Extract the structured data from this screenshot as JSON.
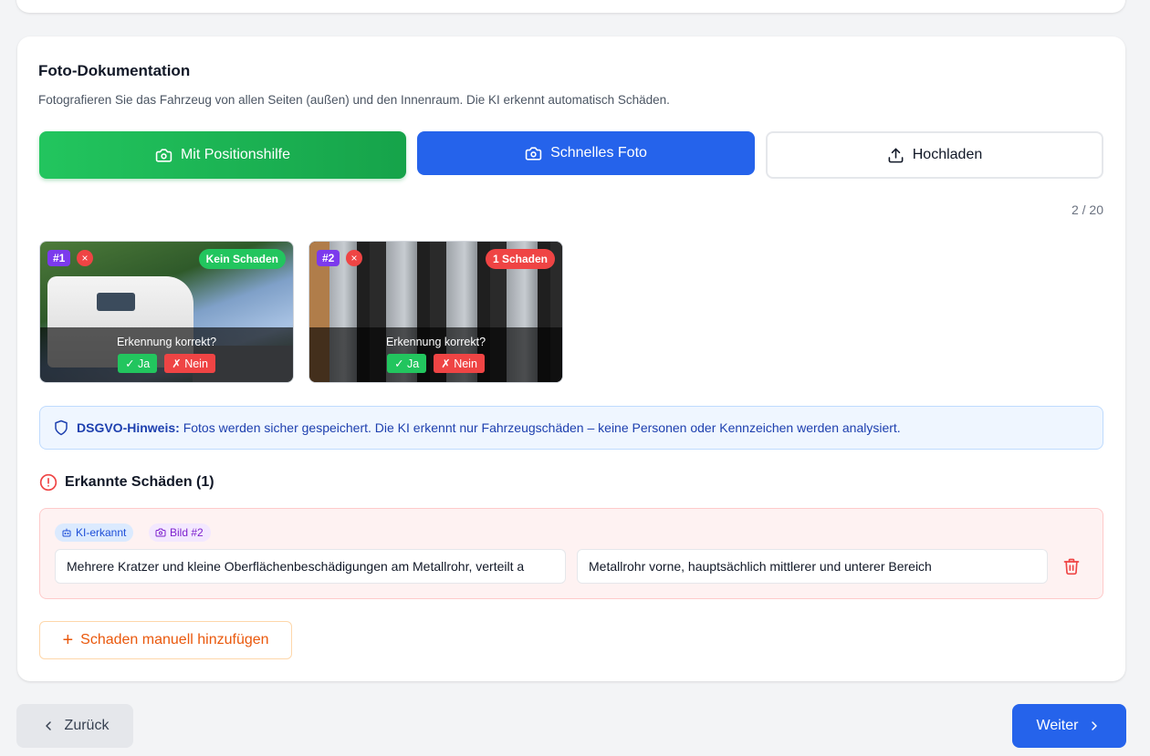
{
  "section": {
    "title": "Foto-Dokumentation",
    "subtitle": "Fotografieren Sie das Fahrzeug von allen Seiten (außen) und den Innenraum. Die KI erkennt automatisch Schäden."
  },
  "actions": {
    "position_help": "Mit Positionshilfe",
    "quick_photo": "Schnelles Foto",
    "upload": "Hochladen"
  },
  "photo_counter": "2 / 20",
  "photos": [
    {
      "number": "#1",
      "remove": "×",
      "status": "Kein Schaden",
      "question": "Erkennung korrekt?",
      "yes": "✓ Ja",
      "no": "✗ Nein"
    },
    {
      "number": "#2",
      "remove": "×",
      "status": "1 Schaden",
      "question": "Erkennung korrekt?",
      "yes": "✓ Ja",
      "no": "✗ Nein"
    }
  ],
  "privacy": {
    "label": "DSGVO-Hinweis:",
    "text": "Fotos werden sicher gespeichert. Die KI erkennt nur Fahrzeugschäden – keine Personen oder Kennzeichen werden analysiert."
  },
  "damages": {
    "heading": "Erkannte Schäden (1)",
    "items": [
      {
        "tag_ai": "KI-erkannt",
        "tag_image": "Bild #2",
        "description": "Mehrere Kratzer und kleine Oberflächenbeschädigungen am Metallrohr, verteilt a",
        "location": "Metallrohr vorne, hauptsächlich mittlerer und unterer Bereich"
      }
    ],
    "add_manual": "Schaden manuell hinzufügen"
  },
  "nav": {
    "back": "Zurück",
    "next": "Weiter"
  },
  "colors": {
    "primary": "#2563eb",
    "success": "#22c55e",
    "danger": "#ef4444",
    "accent_orange": "#ea580c",
    "badge_purple": "#7c3aed"
  }
}
